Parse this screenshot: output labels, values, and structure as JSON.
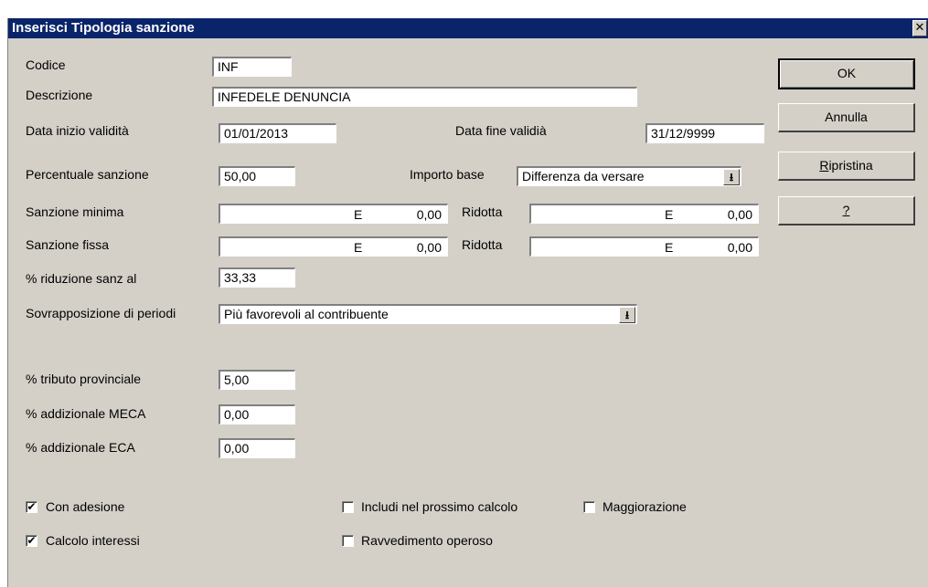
{
  "window": {
    "title": "Inserisci Tipologia sanzione",
    "close_symbol": "✕"
  },
  "labels": {
    "codice": "Codice",
    "descrizione": "Descrizione",
    "data_inizio": "Data inizio validità",
    "data_fine": "Data fine validià",
    "percentuale_sanzione": "Percentuale sanzione",
    "importo_base": "Importo base",
    "sanzione_minima": "Sanzione minima",
    "ridotta_1": "Ridotta",
    "sanzione_fissa": "Sanzione fissa",
    "ridotta_2": "Ridotta",
    "riduzione": "% riduzione sanz al",
    "sovrapposizione": "Sovrapposizione di periodi",
    "tributo_provinciale": "% tributo provinciale",
    "addizionale_meca": "% addizionale MECA",
    "addizionale_eca": "% addizionale ECA"
  },
  "fields": {
    "codice": "INF",
    "descrizione": "INFEDELE DENUNCIA",
    "data_inizio": "01/01/2013",
    "data_fine": "31/12/9999",
    "percentuale_sanzione": "50,00",
    "importo_base": "Differenza da versare",
    "sanzione_minima": {
      "currency": "E",
      "amount": "0,00"
    },
    "sanzione_minima_ridotta": {
      "currency": "E",
      "amount": "0,00"
    },
    "sanzione_fissa": {
      "currency": "E",
      "amount": "0,00"
    },
    "sanzione_fissa_ridotta": {
      "currency": "E",
      "amount": "0,00"
    },
    "riduzione": "33,33",
    "sovrapposizione": "Più favorevoli al contribuente",
    "tributo_provinciale": "5,00",
    "addizionale_meca": "0,00",
    "addizionale_eca": "0,00"
  },
  "combo_icon": "arrow-down-to-line-icon",
  "combo_symbol": "⭳",
  "buttons": {
    "ok": "OK",
    "annulla": "Annulla",
    "ripristina_u": "R",
    "ripristina_rest": "ipristina",
    "help": "?"
  },
  "checkboxes": {
    "con_adesione": {
      "label": "Con adesione",
      "checked": true
    },
    "calcolo_interessi": {
      "label": "Calcolo interessi",
      "checked": true
    },
    "includi_prossimo": {
      "label": "Includi nel prossimo calcolo",
      "checked": false
    },
    "ravvedimento": {
      "label": "Ravvedimento operoso",
      "checked": false
    },
    "maggiorazione": {
      "label": "Maggiorazione",
      "checked": false
    }
  },
  "check_mark": "✔"
}
